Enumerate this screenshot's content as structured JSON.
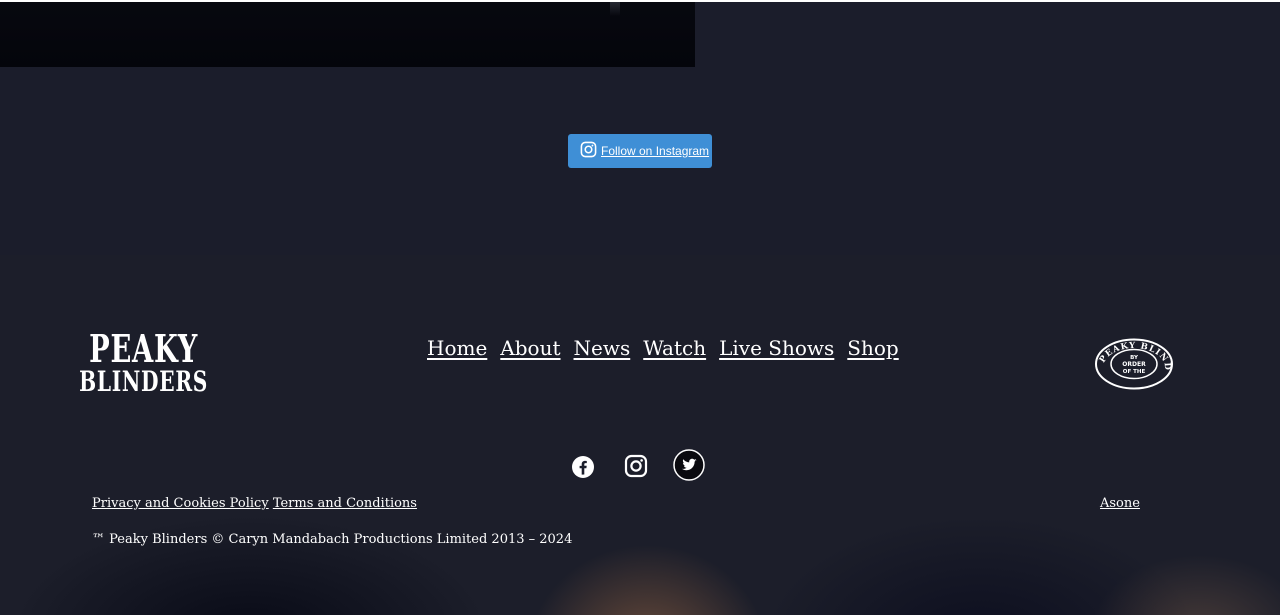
{
  "instagram_feed": {
    "follow_label": "Follow on Instagram",
    "button_color": "#3f8fd6"
  },
  "footer": {
    "logo": {
      "line1": "PEAKY",
      "line2": "BLINDERS"
    },
    "nav": {
      "home": "Home",
      "about": "About",
      "news": "News",
      "watch": "Watch",
      "live_shows": "Live Shows",
      "shop": "Shop"
    },
    "badge": {
      "outer_text": "PEAKY BLINDERS",
      "inner_lines": [
        "BY",
        "ORDER",
        "OF THE"
      ]
    },
    "socials": {
      "facebook_icon": "facebook-icon",
      "instagram_icon": "instagram-icon",
      "twitter_icon": "twitter-icon"
    },
    "legal": {
      "privacy": "Privacy and Cookies Policy",
      "terms": "Terms and Conditions"
    },
    "credit": "Asone",
    "copyright": "™ Peaky Blinders © Caryn Mandabach Productions Limited 2013 – 2024"
  },
  "colors": {
    "background": "#1b1d2b",
    "text": "#ffffff",
    "accent_glow": "#b07448"
  }
}
